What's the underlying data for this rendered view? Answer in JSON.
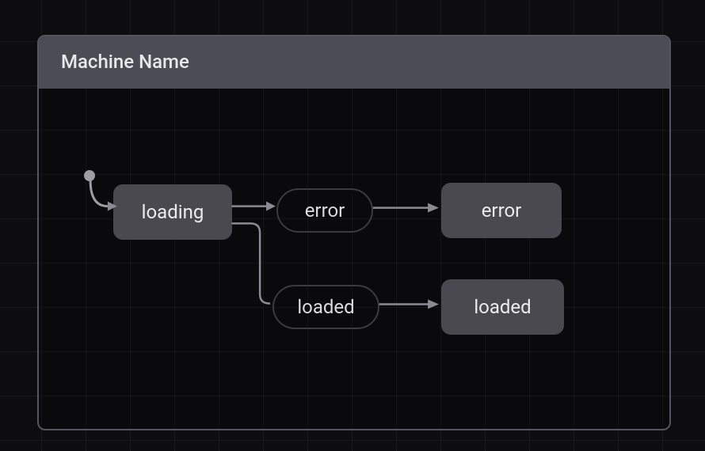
{
  "machine": {
    "title": "Machine Name",
    "initial_state": "loading",
    "states": [
      {
        "id": "loading",
        "label": "loading"
      },
      {
        "id": "error",
        "label": "error"
      },
      {
        "id": "loaded",
        "label": "loaded"
      }
    ],
    "events": [
      {
        "id": "error_event",
        "label": "error",
        "from": "loading",
        "to": "error"
      },
      {
        "id": "loaded_event",
        "label": "loaded",
        "from": "loading",
        "to": "loaded"
      }
    ]
  },
  "colors": {
    "bg": "#0d0d10",
    "panel_border": "#555560",
    "panel_header": "#4c4c55",
    "state_fill": "#49494f",
    "event_border": "#3a3a40",
    "text": "#e8e8ea",
    "connector": "#8b8b93"
  }
}
